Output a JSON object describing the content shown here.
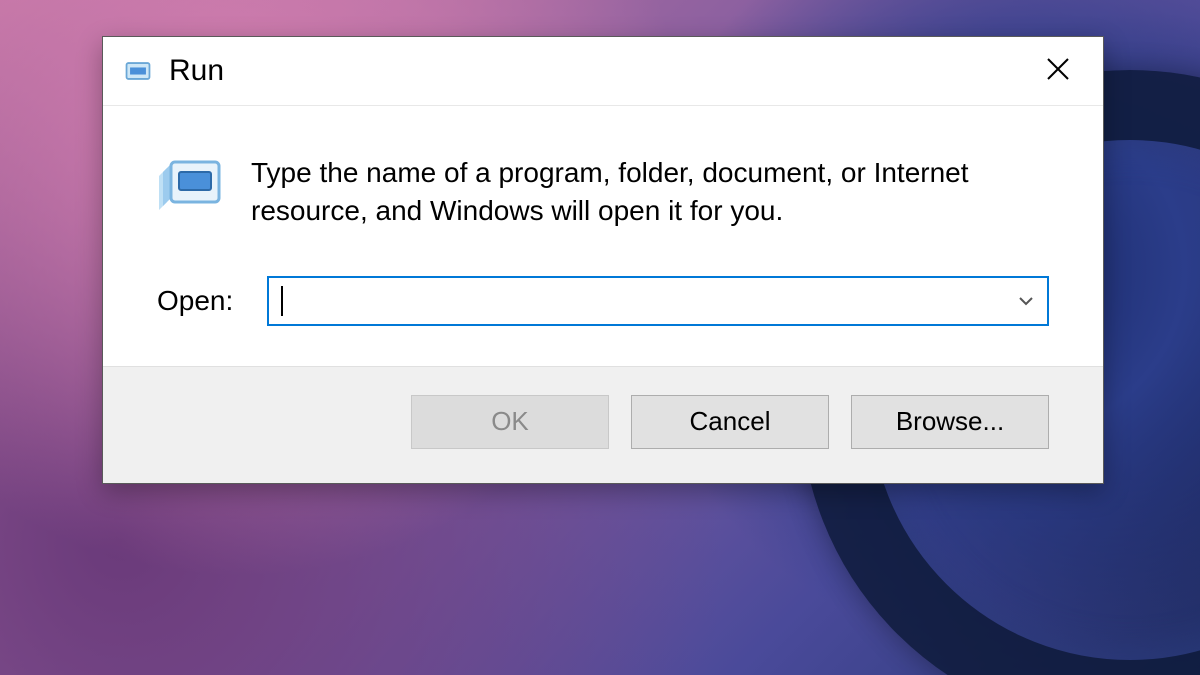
{
  "window": {
    "title": "Run",
    "description": "Type the name of a program, folder, document, or Internet resource, and Windows will open it for you.",
    "open_label": "Open:",
    "open_value": "",
    "buttons": {
      "ok": "OK",
      "cancel": "Cancel",
      "browse": "Browse..."
    }
  }
}
